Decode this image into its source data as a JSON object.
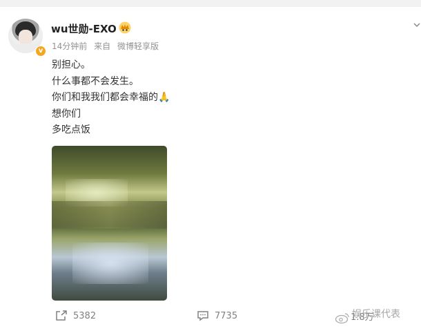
{
  "post": {
    "author": {
      "username": "wu世勋-EXO",
      "avatar_icon": "avatar-photo",
      "verified_icon": "verified-badge-icon",
      "badge_icon": "crown-badge-icon"
    },
    "meta": {
      "time": "14分钟前",
      "source_prefix": "来自",
      "source": "微博轻享版"
    },
    "text_lines": [
      "别担心。",
      "什么事都不会发生。",
      "你们和我我们都会幸福的",
      "想你们",
      "多吃点饭"
    ],
    "emoji": "🙏",
    "image_icon": "river-photo"
  },
  "actions": {
    "repost_count": "5382",
    "comment_count": "7735",
    "like_count": "1.8万"
  },
  "watermark": "娱乐课代表",
  "colors": {
    "verified": "#f5a623",
    "meta_text": "#939393",
    "body_text": "#333333"
  }
}
